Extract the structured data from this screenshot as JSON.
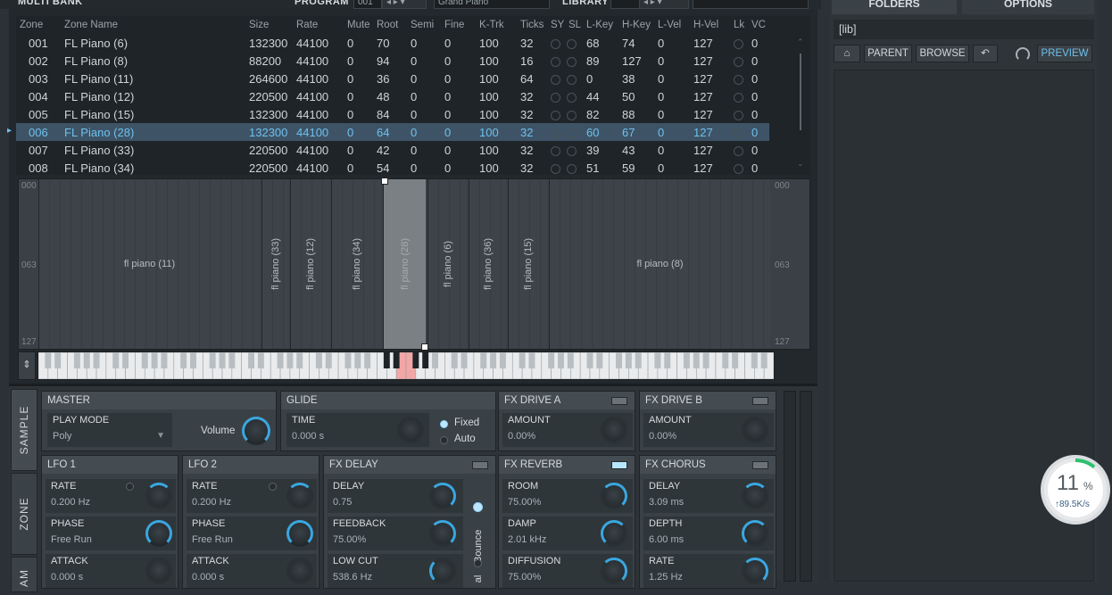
{
  "topbar": {
    "multi_bank": "MULTI BANK",
    "program_label": "PROGRAM",
    "program_number": "001",
    "program_name": "Grand Piano",
    "library_label": "LIBRARY"
  },
  "zone_table": {
    "columns": [
      "Zone",
      "Zone Name",
      "Size",
      "Rate",
      "Mute",
      "Root",
      "Semi",
      "Fine",
      "K-Trk",
      "Ticks",
      "SY",
      "SL",
      "L-Key",
      "H-Key",
      "L-Vel",
      "H-Vel",
      "Lk",
      "VC"
    ],
    "rows": [
      {
        "zone": "001",
        "name": "FL Piano (6)",
        "size": "132300",
        "rate": "44100",
        "mute": "0",
        "root": "70",
        "semi": "0",
        "fine": "0",
        "ktrk": "100",
        "ticks": "32",
        "lkey": "68",
        "hkey": "74",
        "lvel": "0",
        "hvel": "127",
        "vc": "0"
      },
      {
        "zone": "002",
        "name": "FL Piano (8)",
        "size": "88200",
        "rate": "44100",
        "mute": "0",
        "root": "94",
        "semi": "0",
        "fine": "0",
        "ktrk": "100",
        "ticks": "16",
        "lkey": "89",
        "hkey": "127",
        "lvel": "0",
        "hvel": "127",
        "vc": "0"
      },
      {
        "zone": "003",
        "name": "FL Piano (11)",
        "size": "264600",
        "rate": "44100",
        "mute": "0",
        "root": "36",
        "semi": "0",
        "fine": "0",
        "ktrk": "100",
        "ticks": "64",
        "lkey": "0",
        "hkey": "38",
        "lvel": "0",
        "hvel": "127",
        "vc": "0"
      },
      {
        "zone": "004",
        "name": "FL Piano (12)",
        "size": "220500",
        "rate": "44100",
        "mute": "0",
        "root": "48",
        "semi": "0",
        "fine": "0",
        "ktrk": "100",
        "ticks": "32",
        "lkey": "44",
        "hkey": "50",
        "lvel": "0",
        "hvel": "127",
        "vc": "0"
      },
      {
        "zone": "005",
        "name": "FL Piano (15)",
        "size": "132300",
        "rate": "44100",
        "mute": "0",
        "root": "84",
        "semi": "0",
        "fine": "0",
        "ktrk": "100",
        "ticks": "32",
        "lkey": "82",
        "hkey": "88",
        "lvel": "0",
        "hvel": "127",
        "vc": "0"
      },
      {
        "zone": "006",
        "name": "FL Piano (28)",
        "size": "132300",
        "rate": "44100",
        "mute": "0",
        "root": "64",
        "semi": "0",
        "fine": "0",
        "ktrk": "100",
        "ticks": "32",
        "lkey": "60",
        "hkey": "67",
        "lvel": "0",
        "hvel": "127",
        "vc": "0",
        "selected": true
      },
      {
        "zone": "007",
        "name": "FL Piano (33)",
        "size": "220500",
        "rate": "44100",
        "mute": "0",
        "root": "42",
        "semi": "0",
        "fine": "0",
        "ktrk": "100",
        "ticks": "32",
        "lkey": "39",
        "hkey": "43",
        "lvel": "0",
        "hvel": "127",
        "vc": "0"
      },
      {
        "zone": "008",
        "name": "FL Piano (34)",
        "size": "220500",
        "rate": "44100",
        "mute": "0",
        "root": "54",
        "semi": "0",
        "fine": "0",
        "ktrk": "100",
        "ticks": "32",
        "lkey": "51",
        "hkey": "59",
        "lvel": "0",
        "hvel": "127",
        "vc": "0"
      }
    ]
  },
  "keymap": {
    "vel_top": "000",
    "vel_mid": "063",
    "vel_bottom": "127",
    "zones": [
      {
        "label": "fl piano (11)",
        "orient": "h"
      },
      {
        "label": "fl piano (33)",
        "orient": "v"
      },
      {
        "label": "fl piano (12)",
        "orient": "v"
      },
      {
        "label": "fl piano (34)",
        "orient": "v"
      },
      {
        "label": "fl piano (28)",
        "orient": "v",
        "selected": true
      },
      {
        "label": "fl piano (6)",
        "orient": "v"
      },
      {
        "label": "fl piano (36)",
        "orient": "v"
      },
      {
        "label": "fl piano (15)",
        "orient": "v"
      },
      {
        "label": "fl piano (8)",
        "orient": "h"
      }
    ]
  },
  "side_tabs": {
    "sample": "SAMPLE",
    "zone": "ZONE",
    "third": "AM"
  },
  "master": {
    "title": "MASTER",
    "play_mode_label": "PLAY MODE",
    "play_mode_value": "Poly",
    "volume_label": "Volume"
  },
  "glide": {
    "title": "GLIDE",
    "time_label": "TIME",
    "time_value": "0.000 s",
    "fixed_label": "Fixed",
    "auto_label": "Auto"
  },
  "fx_drive_a": {
    "title": "FX DRIVE A",
    "amount_label": "AMOUNT",
    "amount_value": "0.00%"
  },
  "fx_drive_b": {
    "title": "FX DRIVE B",
    "amount_label": "AMOUNT",
    "amount_value": "0.00%"
  },
  "lfo1": {
    "title": "LFO 1",
    "rate_label": "RATE",
    "rate_value": "0.200 Hz",
    "phase_label": "PHASE",
    "phase_value": "Free Run",
    "attack_label": "ATTACK",
    "attack_value": "0.000 s"
  },
  "lfo2": {
    "title": "LFO 2",
    "rate_label": "RATE",
    "rate_value": "0.200 Hz",
    "phase_label": "PHASE",
    "phase_value": "Free Run",
    "attack_label": "ATTACK",
    "attack_value": "0.000 s"
  },
  "fx_delay": {
    "title": "FX DELAY",
    "delay_label": "DELAY",
    "delay_value": "0.75",
    "feedback_label": "FEEDBACK",
    "feedback_value": "75.00%",
    "lowcut_label": "LOW CUT",
    "lowcut_value": "538.6 Hz",
    "bounce_label": "Bounce",
    "normal_label": "al"
  },
  "fx_reverb": {
    "title": "FX REVERB",
    "room_label": "ROOM",
    "room_value": "75.00%",
    "damp_label": "DAMP",
    "damp_value": "2.01 kHz",
    "diffusion_label": "DIFFUSION",
    "diffusion_value": "75.00%"
  },
  "fx_chorus": {
    "title": "FX CHORUS",
    "delay_label": "DELAY",
    "delay_value": "3.09 ms",
    "depth_label": "DEPTH",
    "depth_value": "6.00 ms",
    "rate_label": "RATE",
    "rate_value": "1.25 Hz"
  },
  "right_panel": {
    "tab_folders": "FOLDERS",
    "tab_options": "OPTIONS",
    "path": "[lib]",
    "parent": "PARENT",
    "browse": "BROWSE",
    "preview": "PREVIEW"
  },
  "cpu_widget": {
    "percent": "11",
    "unit": "%",
    "rate": "89.5K/s"
  },
  "colors": {
    "accent": "#3aa7e0",
    "selection": "#3e5466",
    "selected_text": "#6ec0ef"
  }
}
